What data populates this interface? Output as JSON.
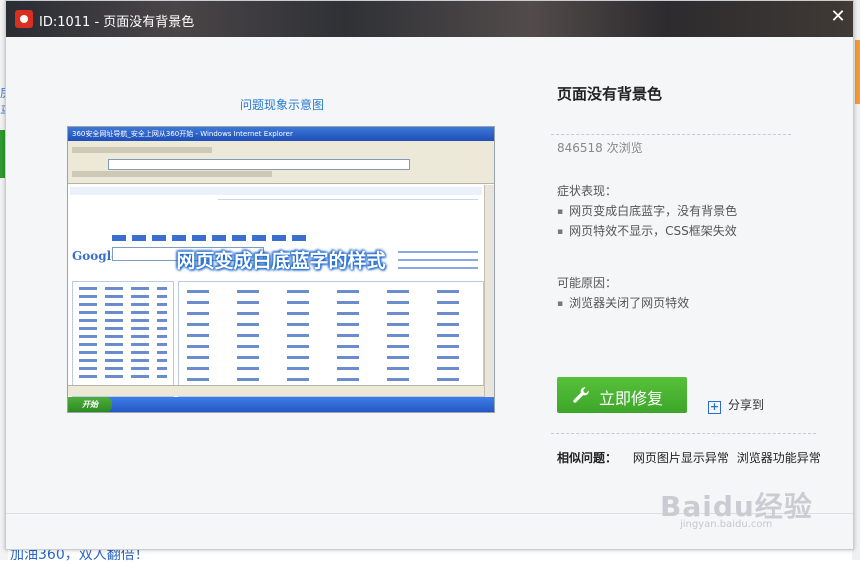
{
  "background": {
    "left_text_1": "房",
    "left_text_2": "马",
    "bottom_link": "加油360，双人翻倍！"
  },
  "dialog": {
    "title": "ID:1011 - 页面没有背景色",
    "close_glyph": "✕"
  },
  "left": {
    "caption": "问题现象示意图",
    "image_overlay_text": "网页变成白底蓝字的样式",
    "ie_title": "360安全网址导航_安全上网从360开始 - Windows Internet Explorer",
    "google_logo": "Google",
    "start_button": "开始"
  },
  "right": {
    "issue_title": "页面没有背景色",
    "views": "846518 次浏览",
    "symptoms_label": "症状表现：",
    "symptoms": [
      "网页变成白底蓝字，没有背景色",
      "网页特效不显示，CSS框架失效"
    ],
    "causes_label": "可能原因：",
    "causes": [
      "浏览器关闭了网页特效"
    ],
    "fix_button": "立即修复",
    "share_label": "分享到",
    "related_label": "相似问题：",
    "related": [
      "网页图片显示异常",
      "浏览器功能异常"
    ]
  },
  "watermark": {
    "brand": "Baidu经验",
    "url": "jingyan.baidu.com"
  },
  "colors": {
    "fix_button": "#4cb632",
    "link_blue": "#2a7ad2",
    "title_bar": "#3a3a3e"
  }
}
